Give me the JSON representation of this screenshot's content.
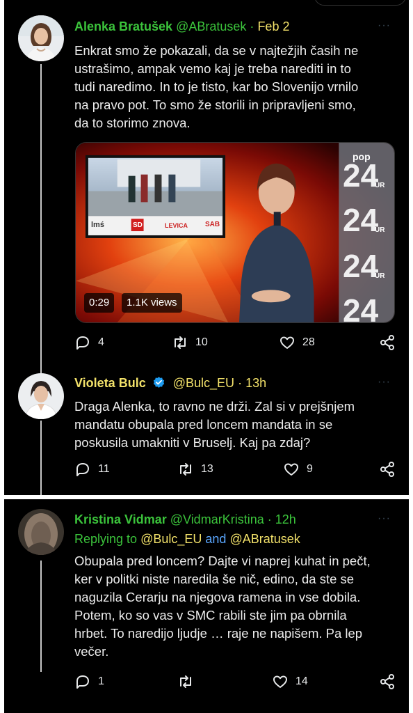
{
  "tweets": [
    {
      "name": "Alenka Bratušek",
      "handle": "@ABratusek",
      "separator": "·",
      "date": "Feb 2",
      "more": "···",
      "text_lines": [
        "Enkrat smo že pokazali, da se v najtežjih časih ne",
        "ustrašimo, ampak vemo kaj je treba narediti in to",
        "tudi naredimo. In to je tisto, kar bo Slovenijo vrnilo",
        "na pravo pot. To smo že storili in pripravljeni smo,",
        "da to storimo znova."
      ],
      "video": {
        "duration": "0:29",
        "views": "1.1K views",
        "logo_text": "pop",
        "channel_numbers": [
          "24",
          "24",
          "24",
          "24"
        ],
        "channel_suffix": "UR",
        "party_labels": [
          "lmś",
          "SD",
          "LEVICA",
          "SAB"
        ]
      },
      "replies": "4",
      "retweets": "10",
      "likes": "28"
    },
    {
      "name": "Violeta Bulc",
      "handle": "@Bulc_EU",
      "separator": "·",
      "date": "13h",
      "more": "···",
      "text_lines": [
        "Draga Alenka, to ravno ne drži. Zal si v prejšnjem",
        "mandatu obupala pred loncem mandata in se",
        "poskusila umakniti v Bruselj. Kaj pa zdaj?"
      ],
      "replies": "11",
      "retweets": "13",
      "likes": "9"
    },
    {
      "name": "Kristina Vidmar",
      "handle": "@VidmarKristina",
      "separator": "·",
      "date": "12h",
      "more": "···",
      "replying_prefix": "Replying to",
      "replying_to_1": "@Bulc_EU",
      "replying_and": "and",
      "replying_to_2": "@ABratusek",
      "text_lines": [
        "Obupala pred loncem? Dajte vi naprej kuhat in pečt,",
        "ker v politki niste naredila še nič, edino, da ste se",
        "naguzila Cerarju na njegova ramena in vse dobila.",
        "Potem, ko so vas v SMC rabili ste jim pa obrnila",
        "hrbet. To naredijo ljudje … raje ne napišem. Pa lep",
        "večer."
      ],
      "replies": "1",
      "retweets": "",
      "likes": "14"
    }
  ],
  "colors": {
    "background": "#000000",
    "name_green": "#3bc33b",
    "mention_yellow": "#f3e26a",
    "link_blue": "#5aa7ff",
    "verified_blue": "#1d9bf0",
    "date_yellow": "#f3e26a"
  },
  "icons": [
    "reply-icon",
    "retweet-icon",
    "like-icon",
    "share-icon",
    "verified-badge-icon",
    "more-icon"
  ]
}
